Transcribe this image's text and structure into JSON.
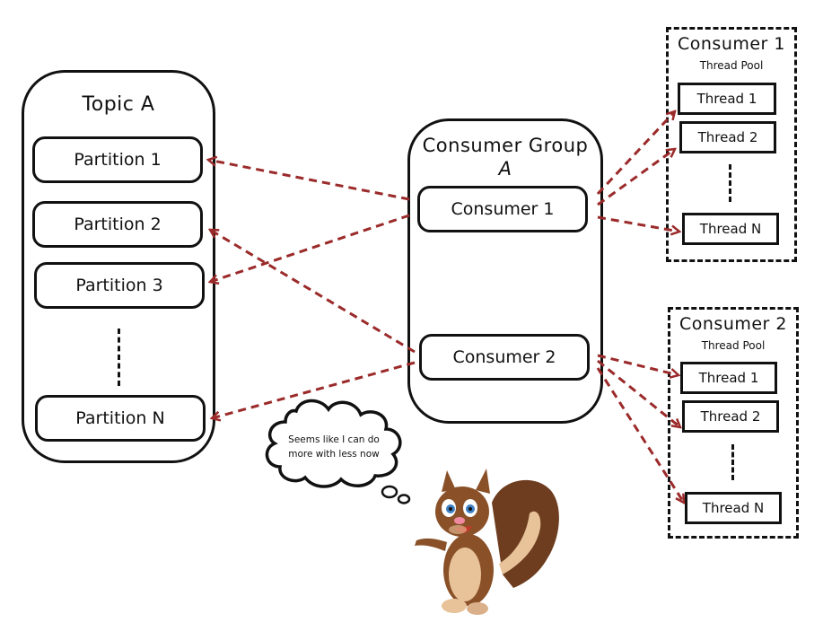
{
  "topic": {
    "title": "Topic A",
    "partitions": [
      "Partition 1",
      "Partition 2",
      "Partition 3",
      "Partition N"
    ]
  },
  "consumer_group": {
    "title_line1": "Consumer Group",
    "title_line2": "A",
    "consumers": [
      "Consumer 1",
      "Consumer 2"
    ]
  },
  "pools": [
    {
      "title": "Consumer 1",
      "subtitle": "Thread Pool",
      "threads": [
        "Thread 1",
        "Thread 2",
        "Thread N"
      ]
    },
    {
      "title": "Consumer 2",
      "subtitle": "Thread Pool",
      "threads": [
        "Thread 1",
        "Thread 2",
        "Thread N"
      ]
    }
  ],
  "thought_bubble": {
    "text": "Seems like I can do more with less now"
  },
  "mascot": {
    "icon": "squirrel-icon"
  },
  "colors": {
    "arrow": "#9b2a2a",
    "stroke": "#111111",
    "background": "#ffffff"
  },
  "connections": [
    {
      "from": "Consumer 1",
      "to": "Partition 1"
    },
    {
      "from": "Consumer 1",
      "to": "Partition 3"
    },
    {
      "from": "Consumer 2",
      "to": "Partition 2"
    },
    {
      "from": "Consumer 2",
      "to": "Partition N"
    },
    {
      "from": "Consumer 1",
      "to": "Consumer 1 / Thread 1"
    },
    {
      "from": "Consumer 1",
      "to": "Consumer 1 / Thread 2"
    },
    {
      "from": "Consumer 1",
      "to": "Consumer 1 / Thread N"
    },
    {
      "from": "Consumer 2",
      "to": "Consumer 2 / Thread 1"
    },
    {
      "from": "Consumer 2",
      "to": "Consumer 2 / Thread 2"
    },
    {
      "from": "Consumer 2",
      "to": "Consumer 2 / Thread N"
    }
  ]
}
